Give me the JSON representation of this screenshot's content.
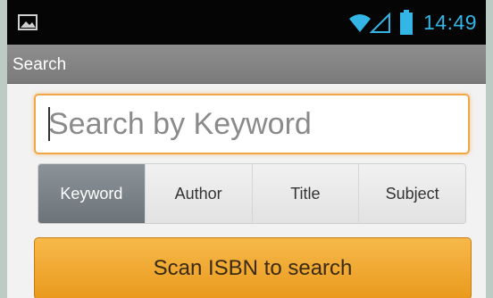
{
  "status_bar": {
    "time": "14:49",
    "accent_color": "#33b5e5",
    "icons": [
      "image-notification-icon",
      "wifi-icon",
      "signal-icon",
      "battery-icon"
    ]
  },
  "action_bar": {
    "title": "Search"
  },
  "search": {
    "placeholder": "Search by Keyword",
    "value": ""
  },
  "search_types": {
    "options": [
      "Keyword",
      "Author",
      "Title",
      "Subject"
    ],
    "selected": "Keyword"
  },
  "scan_button": {
    "label": "Scan ISBN to search"
  },
  "colors": {
    "focus_border": "#f2a646",
    "button_gradient_top": "#f7b94a",
    "button_gradient_bottom": "#e99a1d",
    "selected_tab": "#7d858a"
  }
}
